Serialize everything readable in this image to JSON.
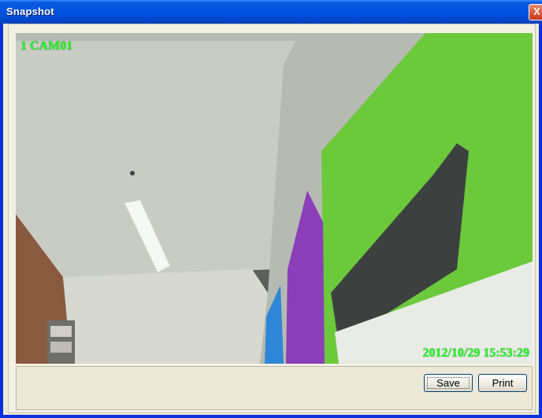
{
  "window": {
    "title": "Snapshot",
    "close_glyph": "X"
  },
  "video": {
    "camera_label": "1 CAM01",
    "timestamp": "2012/10/29 15:53:29"
  },
  "buttons": {
    "save_label": "Save",
    "print_label": "Print"
  },
  "colors": {
    "titlebar": "#0054e3",
    "osd_text": "#22ff22",
    "poster_green": "#6cc93c",
    "poster_purple": "#8a3fb8"
  },
  "icons": {
    "close": "close-icon"
  }
}
